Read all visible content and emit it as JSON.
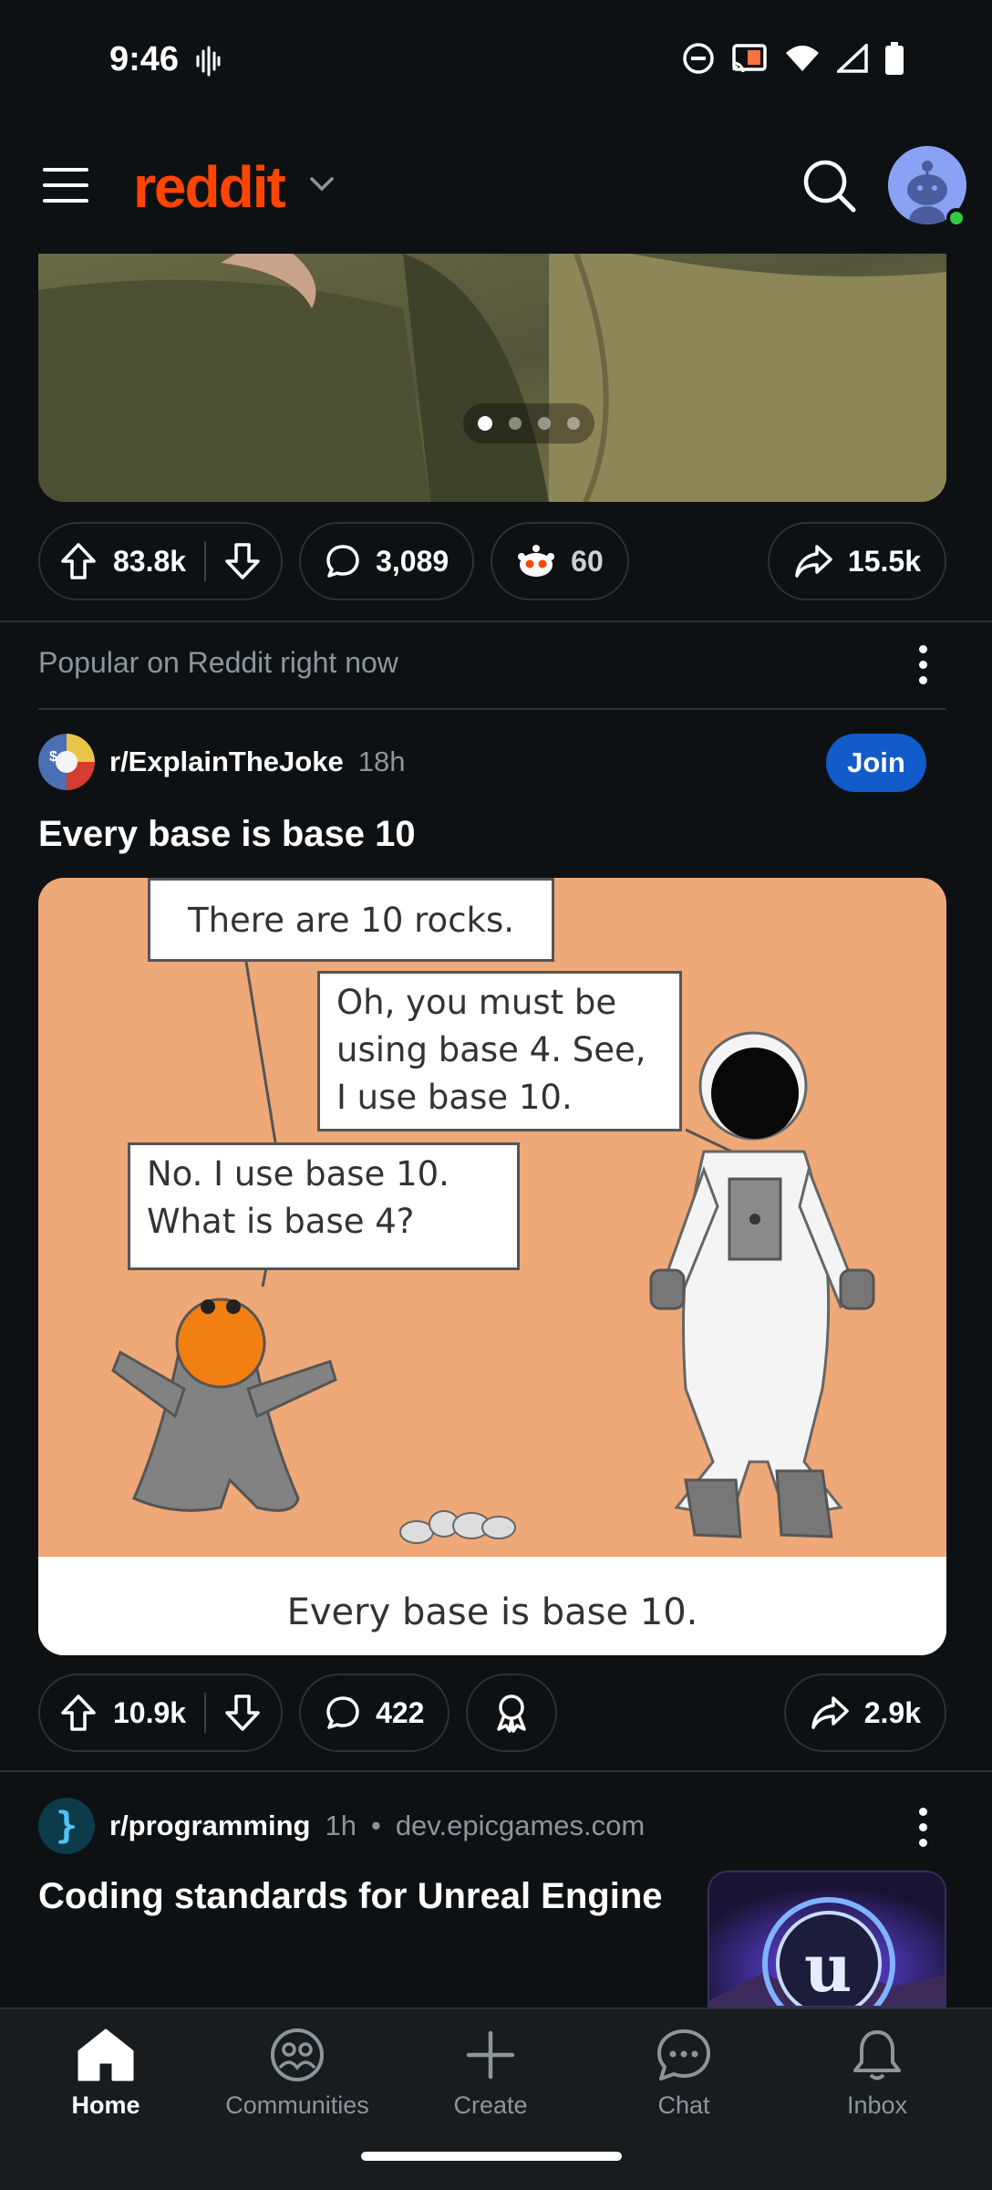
{
  "status_bar": {
    "time": "9:46"
  },
  "header": {
    "logo_text": "reddit"
  },
  "colors": {
    "brand": "#ff4500",
    "join_blue": "#115bca",
    "background": "#0e1113"
  },
  "previous_post": {
    "upvotes": "83.8k",
    "comments": "3,089",
    "awards": "60",
    "shares": "15.5k",
    "carousel_count": 4,
    "carousel_active": 1
  },
  "section_label": "Popular on Reddit right now",
  "post1": {
    "subreddit": "r/ExplainTheJoke",
    "age": "18h",
    "join_label": "Join",
    "title": "Every base is base 10",
    "comic": {
      "bubble1": "There are 10 rocks.",
      "bubble2": "Oh, you must be\nusing base 4.  See,\nI use base 10.",
      "bubble3": "No.  I use base 10.\nWhat is base 4?",
      "caption": "Every base is base 10."
    },
    "upvotes": "10.9k",
    "comments": "422",
    "shares": "2.9k"
  },
  "post2": {
    "subreddit": "r/programming",
    "age": "1h",
    "separator": "•",
    "domain": "dev.epicgames.com",
    "title": "Coding standards for Unreal Engine"
  },
  "bottom_nav": {
    "items": [
      {
        "label": "Home",
        "icon": "home-icon",
        "active": true
      },
      {
        "label": "Communities",
        "icon": "communities-icon",
        "active": false
      },
      {
        "label": "Create",
        "icon": "plus-icon",
        "active": false
      },
      {
        "label": "Chat",
        "icon": "chat-icon",
        "active": false
      },
      {
        "label": "Inbox",
        "icon": "bell-icon",
        "active": false
      }
    ]
  }
}
